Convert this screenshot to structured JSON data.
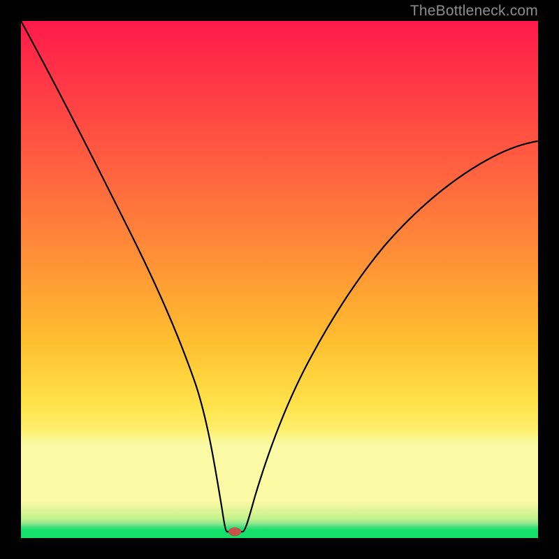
{
  "watermark": "TheBottleneck.com",
  "colors": {
    "frame": "#000000",
    "gradient_top": "#ff1a4a",
    "gradient_mid": "#ffe24a",
    "gradient_band": "#faf9a4",
    "gradient_bottom": "#14e06a",
    "curve": "#000000",
    "marker": "#c9524a"
  },
  "chart_data": {
    "type": "line",
    "title": "",
    "xlabel": "",
    "ylabel": "",
    "xlim": [
      0,
      100
    ],
    "ylim": [
      0,
      100
    ],
    "grid": false,
    "legend": false,
    "annotations": [
      "TheBottleneck.com"
    ],
    "marker": {
      "x": 40,
      "y": 1
    },
    "series": [
      {
        "name": "bottleneck-curve",
        "x": [
          0,
          5,
          10,
          15,
          20,
          25,
          30,
          35,
          37,
          39,
          41,
          43,
          47,
          50,
          55,
          60,
          65,
          70,
          75,
          80,
          85,
          90,
          95,
          100
        ],
        "values": [
          100,
          88,
          76,
          64,
          52,
          40,
          28,
          14,
          6,
          1,
          1,
          1,
          7,
          15,
          27,
          37,
          46,
          53,
          59,
          64,
          68,
          71,
          73,
          74
        ]
      }
    ]
  }
}
